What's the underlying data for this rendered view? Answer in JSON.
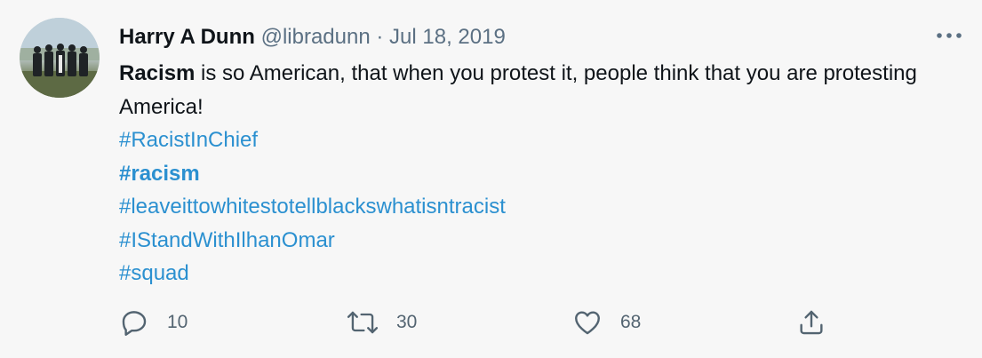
{
  "author": {
    "name": "Harry A Dunn",
    "handle": "@libradunn",
    "separator": "·",
    "date": "Jul 18, 2019"
  },
  "tweet": {
    "bold_lead": "Racism",
    "body": " is so American, that when you protest it, people think that you are protesting America!",
    "hashtags": [
      "#RacistInChief",
      "#racism",
      "#leaveittowhitestotellblackswhatisntracist",
      "#IStandWithIlhanOmar",
      "#squad"
    ]
  },
  "actions": {
    "reply_count": "10",
    "retweet_count": "30",
    "like_count": "68"
  },
  "colors": {
    "background": "#f7f7f7",
    "hashtag": "#2b90d0",
    "secondary_text": "#5b7083"
  },
  "icons": [
    "more-options-icon",
    "reply-icon",
    "retweet-icon",
    "like-icon",
    "share-icon"
  ]
}
